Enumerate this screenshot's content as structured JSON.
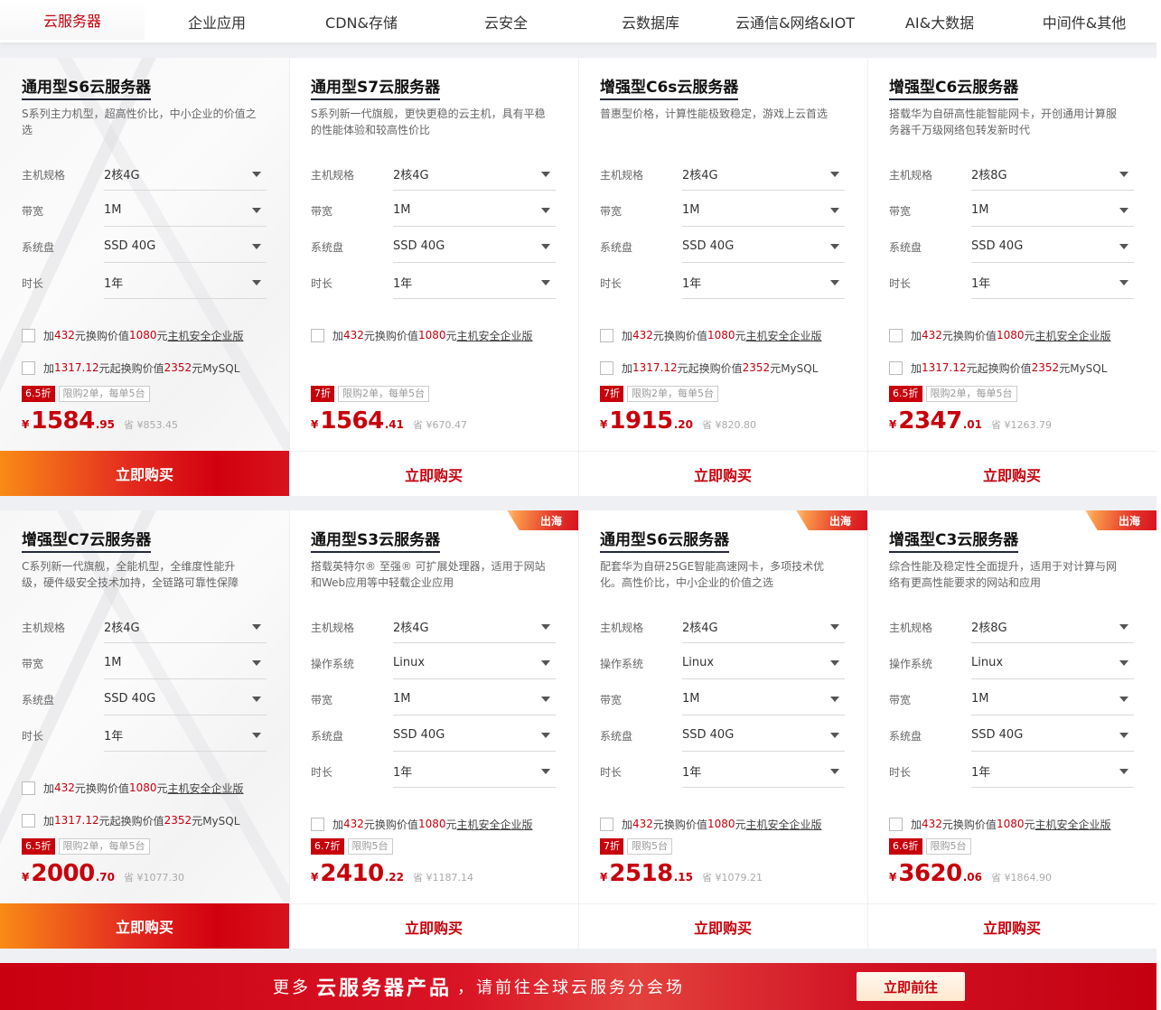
{
  "tabs": [
    "云服务器",
    "企业应用",
    "CDN&存储",
    "云安全",
    "云数据库",
    "云通信&网络&IOT",
    "AI&大数据",
    "中间件&其他"
  ],
  "buy_label": "立即购买",
  "addon_security": {
    "a": "加",
    "b": "432",
    "c": "元换购价值",
    "d": "1080",
    "e": "元",
    "f": "主机安全企业版"
  },
  "addon_mysql": {
    "a": "加",
    "b": "1317.12",
    "c": "元起换购价值",
    "d": "2352",
    "e": "元MySQL"
  },
  "cards": [
    {
      "title": "通用型S6云服务器",
      "desc": "S系列主力机型，超高性价比，中小企业的价值之选",
      "specs": [
        {
          "label": "主机规格",
          "value": "2核4G"
        },
        {
          "label": "带宽",
          "value": "1M"
        },
        {
          "label": "系统盘",
          "value": "SSD 40G"
        },
        {
          "label": "时长",
          "value": "1年"
        }
      ],
      "discount": "6.5折",
      "limit": "限购2单，每单5台",
      "yen": "¥",
      "price_int": "1584",
      "price_dec": ".95",
      "save": "省 ¥853.45",
      "ribbon": ""
    },
    {
      "title": "通用型S7云服务器",
      "desc": "S系列新一代旗舰，更快更稳的云主机，具有平稳的性能体验和较高性价比",
      "specs": [
        {
          "label": "主机规格",
          "value": "2核4G"
        },
        {
          "label": "带宽",
          "value": "1M"
        },
        {
          "label": "系统盘",
          "value": "SSD 40G"
        },
        {
          "label": "时长",
          "value": "1年"
        }
      ],
      "discount": "7折",
      "limit": "限购2单，每单5台",
      "yen": "¥",
      "price_int": "1564",
      "price_dec": ".41",
      "save": "省 ¥670.47",
      "ribbon": ""
    },
    {
      "title": "增强型C6s云服务器",
      "desc": "普惠型价格，计算性能极致稳定，游戏上云首选",
      "specs": [
        {
          "label": "主机规格",
          "value": "2核4G"
        },
        {
          "label": "带宽",
          "value": "1M"
        },
        {
          "label": "系统盘",
          "value": "SSD 40G"
        },
        {
          "label": "时长",
          "value": "1年"
        }
      ],
      "discount": "7折",
      "limit": "限购2单，每单5台",
      "yen": "¥",
      "price_int": "1915",
      "price_dec": ".20",
      "save": "省 ¥820.80",
      "ribbon": ""
    },
    {
      "title": "增强型C6云服务器",
      "desc": "搭载华为自研高性能智能网卡，开创通用计算服务器千万级网络包转发新时代",
      "specs": [
        {
          "label": "主机规格",
          "value": "2核8G"
        },
        {
          "label": "带宽",
          "value": "1M"
        },
        {
          "label": "系统盘",
          "value": "SSD 40G"
        },
        {
          "label": "时长",
          "value": "1年"
        }
      ],
      "discount": "6.5折",
      "limit": "限购2单，每单5台",
      "yen": "¥",
      "price_int": "2347",
      "price_dec": ".01",
      "save": "省 ¥1263.79",
      "ribbon": ""
    },
    {
      "title": "增强型C7云服务器",
      "desc": "C系列新一代旗舰，全能机型，全维度性能升级，硬件级安全技术加持，全链路可靠性保障",
      "specs": [
        {
          "label": "主机规格",
          "value": "2核4G"
        },
        {
          "label": "带宽",
          "value": "1M"
        },
        {
          "label": "系统盘",
          "value": "SSD 40G"
        },
        {
          "label": "时长",
          "value": "1年"
        }
      ],
      "discount": "6.5折",
      "limit": "限购2单，每单5台",
      "yen": "¥",
      "price_int": "2000",
      "price_dec": ".70",
      "save": "省 ¥1077.30",
      "ribbon": ""
    },
    {
      "title": "通用型S3云服务器",
      "desc": "搭载英特尔® 至强® 可扩展处理器，适用于网站和Web应用等中轻载企业应用",
      "specs": [
        {
          "label": "主机规格",
          "value": "2核4G"
        },
        {
          "label": "操作系统",
          "value": "Linux"
        },
        {
          "label": "带宽",
          "value": "1M"
        },
        {
          "label": "系统盘",
          "value": "SSD 40G"
        },
        {
          "label": "时长",
          "value": "1年"
        }
      ],
      "discount": "6.7折",
      "limit": "限购5台",
      "yen": "¥",
      "price_int": "2410",
      "price_dec": ".22",
      "save": "省 ¥1187.14",
      "ribbon": "出海"
    },
    {
      "title": "通用型S6云服务器",
      "desc": "配套华为自研25GE智能高速网卡，多项技术优化。高性价比，中小企业的价值之选",
      "specs": [
        {
          "label": "主机规格",
          "value": "2核4G"
        },
        {
          "label": "操作系统",
          "value": "Linux"
        },
        {
          "label": "带宽",
          "value": "1M"
        },
        {
          "label": "系统盘",
          "value": "SSD 40G"
        },
        {
          "label": "时长",
          "value": "1年"
        }
      ],
      "discount": "7折",
      "limit": "限购5台",
      "yen": "¥",
      "price_int": "2518",
      "price_dec": ".15",
      "save": "省 ¥1079.21",
      "ribbon": "出海"
    },
    {
      "title": "增强型C3云服务器",
      "desc": "综合性能及稳定性全面提升，适用于对计算与网络有更高性能要求的网站和应用",
      "specs": [
        {
          "label": "主机规格",
          "value": "2核8G"
        },
        {
          "label": "操作系统",
          "value": "Linux"
        },
        {
          "label": "带宽",
          "value": "1M"
        },
        {
          "label": "系统盘",
          "value": "SSD 40G"
        },
        {
          "label": "时长",
          "value": "1年"
        }
      ],
      "discount": "6.6折",
      "limit": "限购5台",
      "yen": "¥",
      "price_int": "3620",
      "price_dec": ".06",
      "save": "省 ¥1864.90",
      "ribbon": "出海"
    }
  ],
  "banner": {
    "pre": "更多",
    "big": "云服务器产品",
    "post": "，请前往全球云服务分会场",
    "button": "立即前往"
  }
}
